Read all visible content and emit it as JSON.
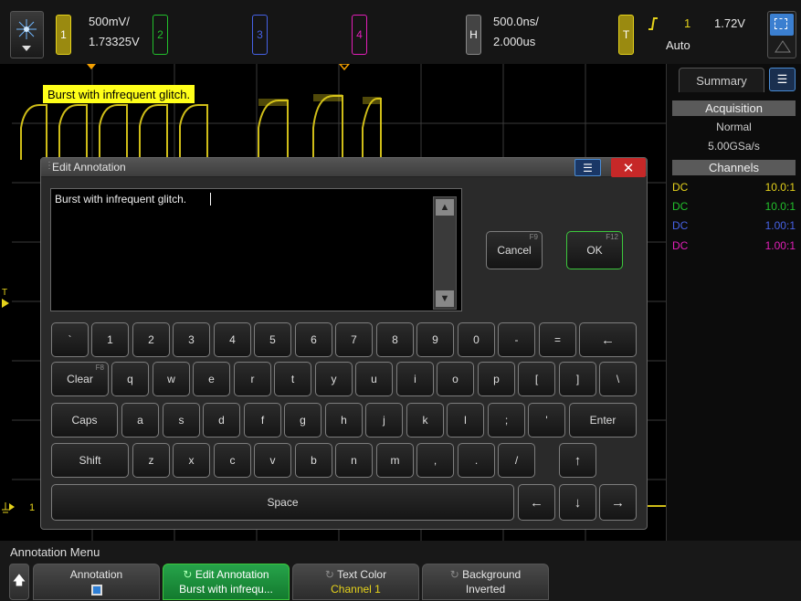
{
  "channels": {
    "ch1": {
      "label": "1",
      "color": "#e5d21b",
      "scale": "500mV/",
      "offset": "1.73325V"
    },
    "ch2": {
      "label": "2",
      "color": "#22c02c"
    },
    "ch3": {
      "label": "3",
      "color": "#4662e6"
    },
    "ch4": {
      "label": "4",
      "color": "#e21fb8"
    }
  },
  "horizontal": {
    "label": "H",
    "scale": "500.0ns/",
    "delay": "2.000us"
  },
  "trigger": {
    "label": "T",
    "source": "1",
    "level": "1.72V",
    "mode": "Auto"
  },
  "annotation_on_screen": "Burst with infrequent glitch.",
  "markers": {
    "trigger_left": "T",
    "ground_left": "1"
  },
  "side_panel": {
    "tab": "Summary",
    "acquisition_header": "Acquisition",
    "acq_mode": "Normal",
    "sample_rate": "5.00GSa/s",
    "channels_header": "Channels",
    "channel_rows": [
      {
        "coupling": "DC",
        "probe": "10.0:1",
        "color": "#e5d21b"
      },
      {
        "coupling": "DC",
        "probe": "10.0:1",
        "color": "#22c02c"
      },
      {
        "coupling": "DC",
        "probe": "1.00:1",
        "color": "#4662e6"
      },
      {
        "coupling": "DC",
        "probe": "1.00:1",
        "color": "#e21fb8"
      }
    ]
  },
  "dialog": {
    "title": "Edit Annotation",
    "text_value": "Burst with infrequent glitch.",
    "cancel_label": "Cancel",
    "cancel_fn": "F9",
    "ok_label": "OK",
    "ok_fn": "F12",
    "keyboard": {
      "row1": [
        "`",
        "1",
        "2",
        "3",
        "4",
        "5",
        "6",
        "7",
        "8",
        "9",
        "0",
        "-",
        "=",
        "←"
      ],
      "clear_label": "Clear",
      "clear_fn": "F8",
      "row2": [
        "q",
        "w",
        "e",
        "r",
        "t",
        "y",
        "u",
        "i",
        "o",
        "p",
        "[",
        "]",
        "\\"
      ],
      "caps_label": "Caps",
      "row3": [
        "a",
        "s",
        "d",
        "f",
        "g",
        "h",
        "j",
        "k",
        "l",
        ";",
        "'"
      ],
      "enter_label": "Enter",
      "shift_label": "Shift",
      "row4": [
        "z",
        "x",
        "c",
        "v",
        "b",
        "n",
        "m",
        ",",
        ".",
        "/"
      ],
      "up_arrow": "↑",
      "space_label": "Space",
      "left_arrow": "←",
      "down_arrow": "↓",
      "right_arrow": "→"
    }
  },
  "menu": {
    "title": "Annotation Menu",
    "back_icon": "up-arrow-icon",
    "softkeys": [
      {
        "label": "Annotation",
        "value": ""
      },
      {
        "label": "Edit Annotation",
        "value": "Burst with infrequ..."
      },
      {
        "label": "Text Color",
        "value": "Channel 1"
      },
      {
        "label": "Background",
        "value": "Inverted"
      }
    ]
  },
  "colors": {
    "accent_blue": "#4a8cd4",
    "ok_green": "#3cc83c",
    "close_red": "#c62828"
  }
}
